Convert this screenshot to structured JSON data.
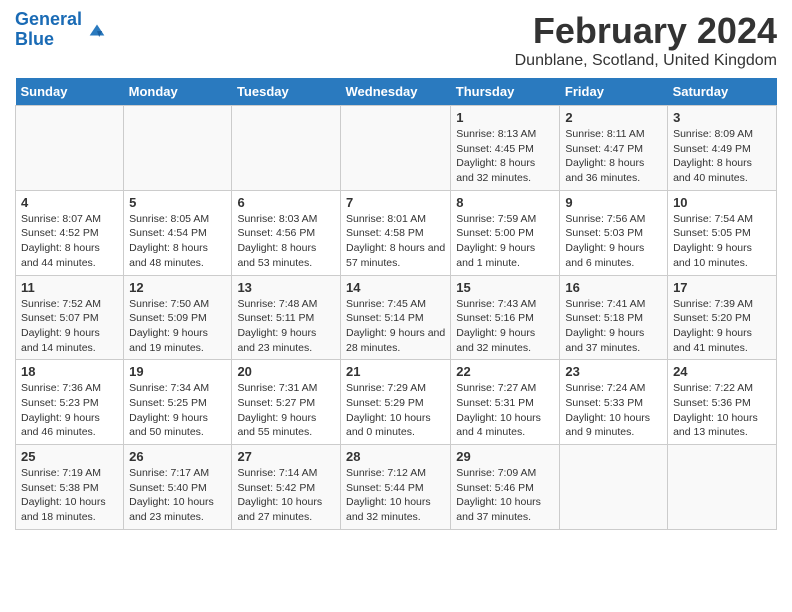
{
  "header": {
    "logo_general": "General",
    "logo_blue": "Blue",
    "title": "February 2024",
    "subtitle": "Dunblane, Scotland, United Kingdom"
  },
  "days_of_week": [
    "Sunday",
    "Monday",
    "Tuesday",
    "Wednesday",
    "Thursday",
    "Friday",
    "Saturday"
  ],
  "weeks": [
    {
      "cells": [
        {
          "date": "",
          "content": ""
        },
        {
          "date": "",
          "content": ""
        },
        {
          "date": "",
          "content": ""
        },
        {
          "date": "",
          "content": ""
        },
        {
          "date": "1",
          "content": "Sunrise: 8:13 AM\nSunset: 4:45 PM\nDaylight: 8 hours and 32 minutes."
        },
        {
          "date": "2",
          "content": "Sunrise: 8:11 AM\nSunset: 4:47 PM\nDaylight: 8 hours and 36 minutes."
        },
        {
          "date": "3",
          "content": "Sunrise: 8:09 AM\nSunset: 4:49 PM\nDaylight: 8 hours and 40 minutes."
        }
      ]
    },
    {
      "cells": [
        {
          "date": "4",
          "content": "Sunrise: 8:07 AM\nSunset: 4:52 PM\nDaylight: 8 hours and 44 minutes."
        },
        {
          "date": "5",
          "content": "Sunrise: 8:05 AM\nSunset: 4:54 PM\nDaylight: 8 hours and 48 minutes."
        },
        {
          "date": "6",
          "content": "Sunrise: 8:03 AM\nSunset: 4:56 PM\nDaylight: 8 hours and 53 minutes."
        },
        {
          "date": "7",
          "content": "Sunrise: 8:01 AM\nSunset: 4:58 PM\nDaylight: 8 hours and 57 minutes."
        },
        {
          "date": "8",
          "content": "Sunrise: 7:59 AM\nSunset: 5:00 PM\nDaylight: 9 hours and 1 minute."
        },
        {
          "date": "9",
          "content": "Sunrise: 7:56 AM\nSunset: 5:03 PM\nDaylight: 9 hours and 6 minutes."
        },
        {
          "date": "10",
          "content": "Sunrise: 7:54 AM\nSunset: 5:05 PM\nDaylight: 9 hours and 10 minutes."
        }
      ]
    },
    {
      "cells": [
        {
          "date": "11",
          "content": "Sunrise: 7:52 AM\nSunset: 5:07 PM\nDaylight: 9 hours and 14 minutes."
        },
        {
          "date": "12",
          "content": "Sunrise: 7:50 AM\nSunset: 5:09 PM\nDaylight: 9 hours and 19 minutes."
        },
        {
          "date": "13",
          "content": "Sunrise: 7:48 AM\nSunset: 5:11 PM\nDaylight: 9 hours and 23 minutes."
        },
        {
          "date": "14",
          "content": "Sunrise: 7:45 AM\nSunset: 5:14 PM\nDaylight: 9 hours and 28 minutes."
        },
        {
          "date": "15",
          "content": "Sunrise: 7:43 AM\nSunset: 5:16 PM\nDaylight: 9 hours and 32 minutes."
        },
        {
          "date": "16",
          "content": "Sunrise: 7:41 AM\nSunset: 5:18 PM\nDaylight: 9 hours and 37 minutes."
        },
        {
          "date": "17",
          "content": "Sunrise: 7:39 AM\nSunset: 5:20 PM\nDaylight: 9 hours and 41 minutes."
        }
      ]
    },
    {
      "cells": [
        {
          "date": "18",
          "content": "Sunrise: 7:36 AM\nSunset: 5:23 PM\nDaylight: 9 hours and 46 minutes."
        },
        {
          "date": "19",
          "content": "Sunrise: 7:34 AM\nSunset: 5:25 PM\nDaylight: 9 hours and 50 minutes."
        },
        {
          "date": "20",
          "content": "Sunrise: 7:31 AM\nSunset: 5:27 PM\nDaylight: 9 hours and 55 minutes."
        },
        {
          "date": "21",
          "content": "Sunrise: 7:29 AM\nSunset: 5:29 PM\nDaylight: 10 hours and 0 minutes."
        },
        {
          "date": "22",
          "content": "Sunrise: 7:27 AM\nSunset: 5:31 PM\nDaylight: 10 hours and 4 minutes."
        },
        {
          "date": "23",
          "content": "Sunrise: 7:24 AM\nSunset: 5:33 PM\nDaylight: 10 hours and 9 minutes."
        },
        {
          "date": "24",
          "content": "Sunrise: 7:22 AM\nSunset: 5:36 PM\nDaylight: 10 hours and 13 minutes."
        }
      ]
    },
    {
      "cells": [
        {
          "date": "25",
          "content": "Sunrise: 7:19 AM\nSunset: 5:38 PM\nDaylight: 10 hours and 18 minutes."
        },
        {
          "date": "26",
          "content": "Sunrise: 7:17 AM\nSunset: 5:40 PM\nDaylight: 10 hours and 23 minutes."
        },
        {
          "date": "27",
          "content": "Sunrise: 7:14 AM\nSunset: 5:42 PM\nDaylight: 10 hours and 27 minutes."
        },
        {
          "date": "28",
          "content": "Sunrise: 7:12 AM\nSunset: 5:44 PM\nDaylight: 10 hours and 32 minutes."
        },
        {
          "date": "29",
          "content": "Sunrise: 7:09 AM\nSunset: 5:46 PM\nDaylight: 10 hours and 37 minutes."
        },
        {
          "date": "",
          "content": ""
        },
        {
          "date": "",
          "content": ""
        }
      ]
    }
  ]
}
